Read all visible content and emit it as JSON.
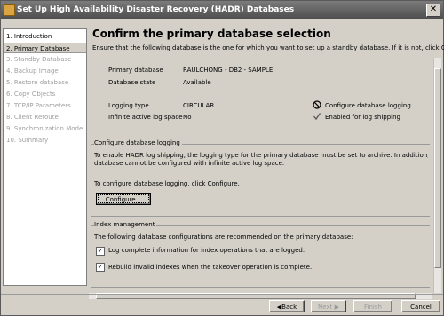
{
  "window": {
    "title": "Set Up High Availability Disaster Recovery (HADR) Databases",
    "close_glyph": "✕"
  },
  "steps": [
    {
      "label": "1. Introduction",
      "state": "enabled"
    },
    {
      "label": "2. Primary Database",
      "state": "active"
    },
    {
      "label": "3. Standby Database",
      "state": "disabled"
    },
    {
      "label": "4. Backup Image",
      "state": "disabled"
    },
    {
      "label": "5. Restore database",
      "state": "disabled"
    },
    {
      "label": "6. Copy Objects",
      "state": "disabled"
    },
    {
      "label": "7. TCP/IP Parameters",
      "state": "disabled"
    },
    {
      "label": "8. Client Reroute",
      "state": "disabled"
    },
    {
      "label": "9. Synchronization Mode",
      "state": "disabled"
    },
    {
      "label": "10. Summary",
      "state": "disabled"
    }
  ],
  "main": {
    "title": "Confirm the primary database selection",
    "description": "Ensure that the following database is the one for which you want to set up a standby database. If it is not, click Cancel.",
    "primary_database_label": "Primary database",
    "primary_database_value": "RAULCHONG - DB2 - SAMPLE",
    "database_state_label": "Database state",
    "database_state_value": "Available",
    "logging_type_label": "Logging type",
    "logging_type_value": "CIRCULAR",
    "infinite_log_label": "Infinite active log space",
    "infinite_log_value": "No",
    "status_configure_logging": "Configure database logging",
    "status_configure_icon": "no-entry-icon",
    "status_log_shipping": "Enabled for log shipping",
    "status_log_shipping_icon": "checkmark-icon"
  },
  "logging_group": {
    "title": "Configure database logging",
    "text1": "To enable HADR log shipping, the logging type for the primary database must be set to archive. In addition, the primary",
    "text2": "database cannot be configured with infinite active log space.",
    "text3": "To configure database logging, click Configure.",
    "configure_button": "Configure..."
  },
  "index_group": {
    "title": "Index management",
    "text": "The following database configurations are recommended on the primary database:",
    "check1_label": "Log complete information for index operations that are logged.",
    "check1_checked": true,
    "check2_label": "Rebuild invalid indexes when the takeover operation is complete.",
    "check2_checked": true
  },
  "buttons": {
    "back": "◀Back",
    "next": "Next ▶",
    "finish": "Finish",
    "cancel": "Cancel"
  }
}
